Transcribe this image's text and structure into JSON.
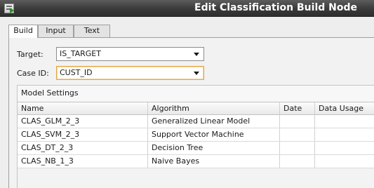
{
  "window": {
    "title": "Edit Classification Build Node",
    "icon": "build-node-icon"
  },
  "tabs": [
    {
      "label": "Build",
      "active": true
    },
    {
      "label": "Input",
      "active": false
    },
    {
      "label": "Text",
      "active": false
    }
  ],
  "form": {
    "target_label": "Target:",
    "target_value": "IS_TARGET",
    "caseid_label": "Case ID:",
    "caseid_value": "CUST_ID"
  },
  "model_settings": {
    "title": "Model Settings",
    "columns": [
      "Name",
      "Algorithm",
      "Date",
      "Data Usage"
    ],
    "rows": [
      {
        "name": "CLAS_GLM_2_3",
        "algorithm": "Generalized Linear Model",
        "date": "",
        "data_usage": ""
      },
      {
        "name": "CLAS_SVM_2_3",
        "algorithm": "Support Vector Machine",
        "date": "",
        "data_usage": ""
      },
      {
        "name": "CLAS_DT_2_3",
        "algorithm": "Decision Tree",
        "date": "",
        "data_usage": ""
      },
      {
        "name": "CLAS_NB_1_3",
        "algorithm": "Naive Bayes",
        "date": "",
        "data_usage": ""
      }
    ]
  },
  "colors": {
    "titlebar": "#3a3a3a",
    "focus_border": "#e0a94a"
  }
}
